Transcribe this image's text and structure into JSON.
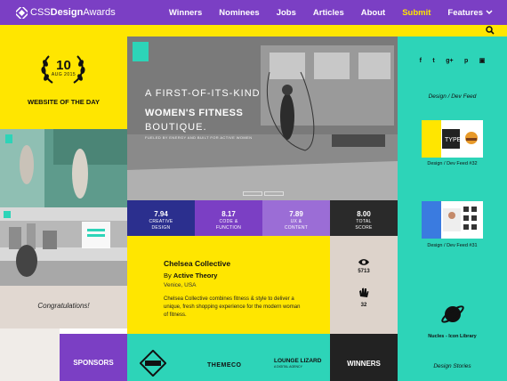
{
  "brand": {
    "name_prefix": "CSS",
    "name_bold": "Design",
    "name_suffix": "Awards"
  },
  "nav": {
    "winners": "Winners",
    "nominees": "Nominees",
    "jobs": "Jobs",
    "articles": "Articles",
    "about": "About",
    "submit": "Submit",
    "features": "Features"
  },
  "award": {
    "number": "10",
    "date": "AUG 2015",
    "label": "WEBSITE OF THE DAY"
  },
  "hero": {
    "line1": "A FIRST-OF-ITS-KIND",
    "line2": "WOMEN'S FITNESS",
    "line3": "BOUTIQUE.",
    "tagline": "FUELED BY ENERGY AND BUILT FOR ACTIVE WOMEN"
  },
  "scores": [
    {
      "value": "7.94",
      "label1": "CREATIVE",
      "label2": "DESIGN",
      "color": "#2b2f8e"
    },
    {
      "value": "8.17",
      "label1": "CODE &",
      "label2": "FUNCTION",
      "color": "#7b3fc4"
    },
    {
      "value": "7.89",
      "label1": "UX &",
      "label2": "CONTENT",
      "color": "#9b6dd6"
    },
    {
      "value": "8.00",
      "label1": "TOTAL",
      "label2": "SCORE",
      "color": "#2a2a2a"
    }
  ],
  "site": {
    "title": "Chelsea Collective",
    "by_prefix": "By",
    "by_name": "Active Theory",
    "location": "Venice, USA",
    "description": "Chelsea Collective combines fitness & style to deliver a unique, fresh shopping experience for the modern woman of fitness."
  },
  "stats": {
    "views": "5713",
    "likes": "32"
  },
  "congrats": "Congratulations!",
  "sponsors": {
    "title": "SPONSORS",
    "sponsor2": "THEMECO",
    "sponsor3": "LOUNGE LIZARD",
    "sponsor3_sub": "A DIGITAL AGENCY"
  },
  "winners_label": "WINNERS",
  "sidebar": {
    "social_icons": [
      "facebook-icon",
      "twitter-icon",
      "google-plus-icon",
      "pinterest-icon",
      "instagram-icon"
    ],
    "feed_heading": "Design / Dev Feed",
    "feed_items": [
      {
        "caption": "Design / Dev Feed #32"
      },
      {
        "caption": "Design / Dev Feed #31"
      }
    ],
    "nucles": "Nucles - Icon Library",
    "stories": "Design Stories"
  },
  "colors": {
    "purple": "#7b3fc4",
    "yellow": "#ffe600",
    "teal": "#2dd4b8",
    "dark": "#222222",
    "beige": "#ddd3cb"
  }
}
